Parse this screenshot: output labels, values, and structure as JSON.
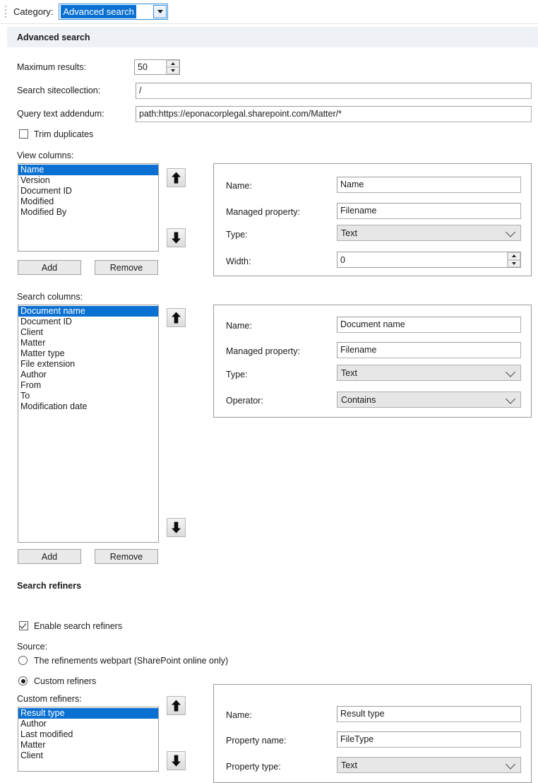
{
  "topbar": {
    "category_label": "Category:",
    "category_value": "Advanced search",
    "dropdown_icon": "chevron-down-icon",
    "grip_icon": "drag-grip-icon"
  },
  "section": {
    "title": "Advanced search"
  },
  "general": {
    "maximum_results_label": "Maximum results:",
    "maximum_results_value": "50",
    "search_sitecollection_label": "Search sitecollection:",
    "search_sitecollection_value": "/",
    "query_text_addendum_label": "Query text addendum:",
    "query_text_addendum_value": "path:https://eponacorplegal.sharepoint.com/Matter/*",
    "trim_duplicates_label": "Trim duplicates",
    "trim_duplicates_checked": false
  },
  "view_columns": {
    "label": "View columns:",
    "items": [
      {
        "label": "Name",
        "selected": true
      },
      {
        "label": "Version",
        "selected": false
      },
      {
        "label": "Document ID",
        "selected": false
      },
      {
        "label": "Modified",
        "selected": false
      },
      {
        "label": "Modified By",
        "selected": false
      }
    ],
    "move_up_icon": "arrow-up-icon",
    "move_down_icon": "arrow-down-icon",
    "add_label": "Add",
    "remove_label": "Remove",
    "detail": {
      "name_label": "Name:",
      "name_value": "Name",
      "managed_property_label": "Managed property:",
      "managed_property_value": "Filename",
      "type_label": "Type:",
      "type_value": "Text",
      "width_label": "Width:",
      "width_value": "0"
    }
  },
  "search_columns": {
    "label": "Search columns:",
    "items": [
      {
        "label": "Document name",
        "selected": true
      },
      {
        "label": "Document ID",
        "selected": false
      },
      {
        "label": "Client",
        "selected": false
      },
      {
        "label": "Matter",
        "selected": false
      },
      {
        "label": "Matter type",
        "selected": false
      },
      {
        "label": "File extension",
        "selected": false
      },
      {
        "label": "Author",
        "selected": false
      },
      {
        "label": "From",
        "selected": false
      },
      {
        "label": "To",
        "selected": false
      },
      {
        "label": "Modification date",
        "selected": false
      }
    ],
    "move_up_icon": "arrow-up-icon",
    "move_down_icon": "arrow-down-icon",
    "add_label": "Add",
    "remove_label": "Remove",
    "detail": {
      "name_label": "Name:",
      "name_value": "Document name",
      "managed_property_label": "Managed property:",
      "managed_property_value": "Filename",
      "type_label": "Type:",
      "type_value": "Text",
      "operator_label": "Operator:",
      "operator_value": "Contains"
    }
  },
  "search_refiners": {
    "title": "Search refiners",
    "enable_label": "Enable search refiners",
    "enable_checked": true,
    "source_label": "Source:",
    "options": [
      {
        "label": "The refinements webpart (SharePoint online only)",
        "selected": false
      },
      {
        "label": "Custom refiners",
        "selected": true
      }
    ]
  },
  "custom_refiners": {
    "label": "Custom refiners:",
    "items": [
      {
        "label": "Result type",
        "selected": true
      },
      {
        "label": "Author",
        "selected": false
      },
      {
        "label": "Last modified",
        "selected": false
      },
      {
        "label": "Matter",
        "selected": false
      },
      {
        "label": "Client",
        "selected": false
      }
    ],
    "move_up_icon": "arrow-up-icon",
    "move_down_icon": "arrow-down-icon",
    "detail": {
      "name_label": "Name:",
      "name_value": "Result type",
      "property_name_label": "Property name:",
      "property_name_value": "FileType",
      "property_type_label": "Property type:",
      "property_type_value": "Text"
    }
  },
  "colors": {
    "selection_blue": "#0a70d2",
    "band_background": "#eef1f6",
    "control_gray": "#e6e6e6"
  }
}
